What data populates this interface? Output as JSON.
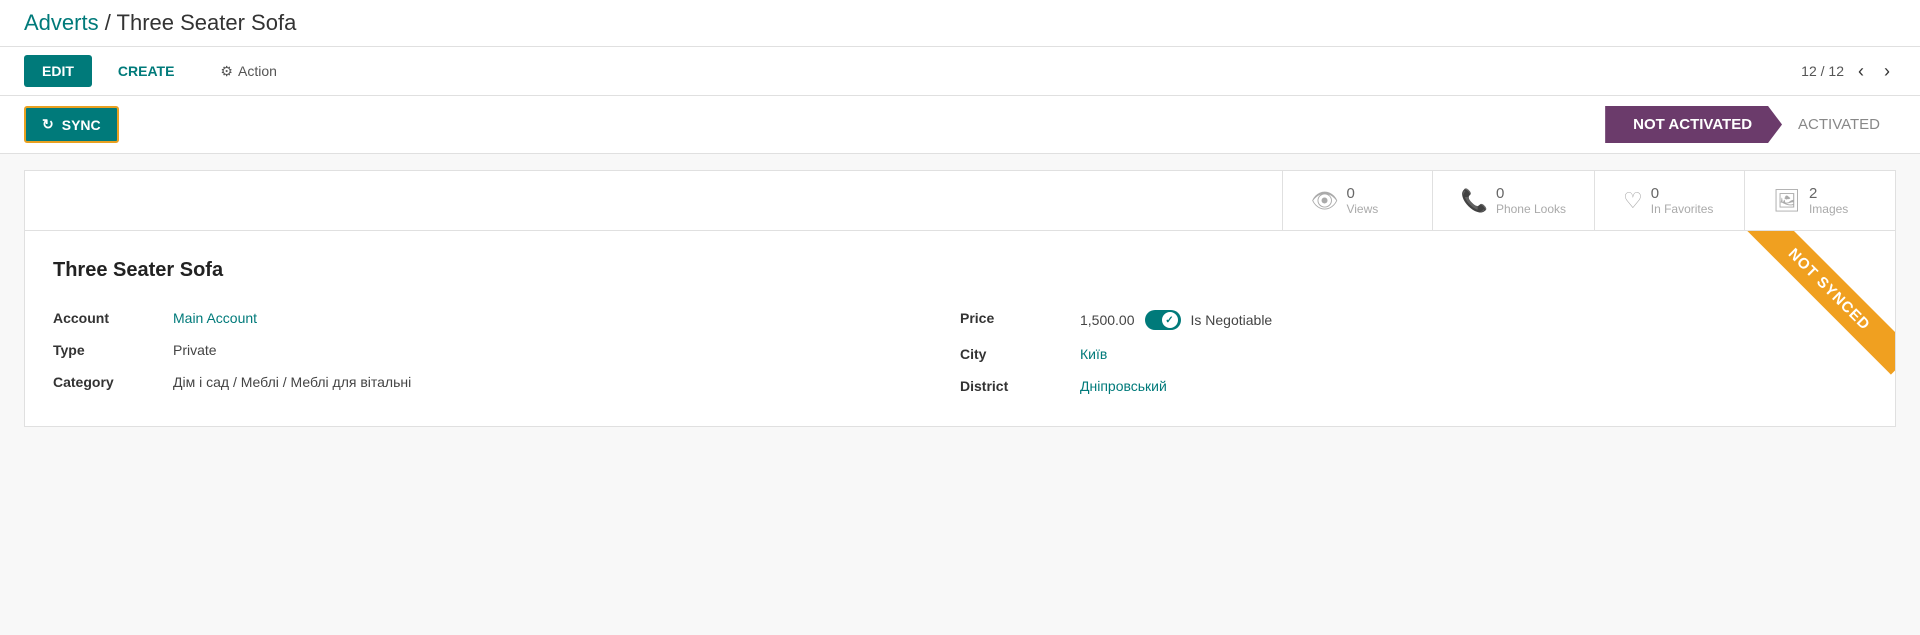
{
  "breadcrumb": {
    "parent": "Adverts",
    "separator": "/",
    "current": "Three Seater Sofa"
  },
  "toolbar": {
    "edit_label": "EDIT",
    "create_label": "CREATE",
    "action_label": "Action",
    "pagination": {
      "current": "12",
      "total": "12",
      "display": "12 / 12"
    }
  },
  "sync_bar": {
    "sync_label": "SYNC",
    "sync_icon": "↻"
  },
  "status": {
    "not_activated": "NOT ACTIVATED",
    "activated": "ACTIVATED"
  },
  "stats": {
    "views": {
      "count": "0",
      "label": "Views"
    },
    "phone_looks": {
      "count": "0",
      "label": "Phone Looks"
    },
    "in_favorites": {
      "count": "0",
      "label": "In Favorites"
    },
    "images": {
      "count": "2",
      "label": "Images"
    }
  },
  "detail": {
    "title": "Three Seater Sofa",
    "ribbon": "NOT SYNCED",
    "fields_left": [
      {
        "label": "Account",
        "value": "Main Account",
        "type": "link"
      },
      {
        "label": "Type",
        "value": "Private",
        "type": "text"
      },
      {
        "label": "Category",
        "value": "Дім і сад / Меблі / Меблі для вітальні",
        "type": "text"
      }
    ],
    "fields_right": [
      {
        "label": "Price",
        "value": "1,500.00",
        "extra": "Is Negotiable",
        "type": "price"
      },
      {
        "label": "City",
        "value": "Київ",
        "type": "link"
      },
      {
        "label": "District",
        "value": "Дніпровський",
        "type": "link"
      }
    ]
  }
}
